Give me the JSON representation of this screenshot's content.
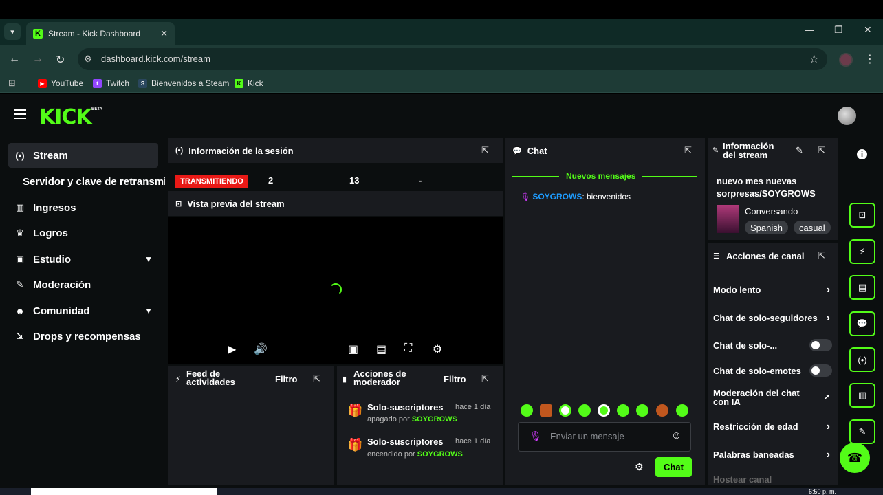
{
  "browser": {
    "tab_title": "Stream - Kick Dashboard",
    "favicon": "K",
    "tab_close": "✕",
    "new_tab": "+",
    "url": "dashboard.kick.com/stream",
    "bookmarks": [
      {
        "label": "YouTube",
        "icon": "youtube-icon",
        "color": "#ff0000"
      },
      {
        "label": "Twitch",
        "icon": "twitch-icon",
        "color": "#9146ff"
      },
      {
        "label": "Bienvenidos a Steam",
        "icon": "steam-icon",
        "color": "#1b2838"
      },
      {
        "label": "Kick",
        "icon": "kick-icon",
        "color": "#53fc18"
      }
    ]
  },
  "header": {
    "logo": "KICK",
    "beta": "BETA"
  },
  "sidebar": {
    "items": [
      {
        "label": "Stream",
        "icon": "stream-icon",
        "glyph": "(•)"
      },
      {
        "label": "Servidor y clave de retransmisión"
      },
      {
        "label": "Ingresos",
        "icon": "income-icon",
        "glyph": "▥"
      },
      {
        "label": "Logros",
        "icon": "trophy-icon",
        "glyph": "♛"
      },
      {
        "label": "Estudio",
        "icon": "studio-icon",
        "glyph": "▣"
      },
      {
        "label": "Moderación",
        "icon": "wrench-icon",
        "glyph": "✎"
      },
      {
        "label": "Comunidad",
        "icon": "community-icon",
        "glyph": "☻"
      },
      {
        "label": "Drops y recompensas",
        "icon": "drops-icon",
        "glyph": "⇲"
      }
    ]
  },
  "session": {
    "title": "Información de la sesión",
    "live_badge": "TRANSMITIENDO",
    "stats": [
      "2",
      "13",
      "-"
    ]
  },
  "preview": {
    "title": "Vista previa del stream"
  },
  "activity_feed": {
    "title_line1": "Feed de",
    "title_line2": "actividades",
    "filter": "Filtro"
  },
  "mod_actions": {
    "title_line1": "Acciones de",
    "title_line2": "moderador",
    "filter": "Filtro",
    "entries": [
      {
        "title": "Solo-suscriptores",
        "time": "hace 1 día",
        "by_text": "apagado por ",
        "by_user": "SOYGROWS"
      },
      {
        "title": "Solo-suscriptores",
        "time": "hace 1 día",
        "by_text": "encendido por ",
        "by_user": "SOYGROWS"
      }
    ]
  },
  "chat": {
    "title": "Chat",
    "new_messages": "Nuevos mensajes",
    "messages": [
      {
        "user": "SOYGROWS",
        "text": ": bienvenidos"
      }
    ],
    "input_placeholder": "Enviar un mensaje",
    "send_label": "Chat"
  },
  "stream_info": {
    "title_line1": "Información",
    "title_line2": "del stream",
    "stream_title_line1": "nuevo mes nuevas",
    "stream_title_line2": "sorpresas/SOYGROWS",
    "category": "Conversando",
    "tags": [
      "Spanish",
      "casual"
    ]
  },
  "channel_actions": {
    "title": "Acciones de canal",
    "rows": [
      {
        "label": "Modo lento",
        "control": "chevron"
      },
      {
        "label": "Chat de solo-seguidores",
        "control": "chevron"
      },
      {
        "label": "Chat de solo-...",
        "control": "toggle"
      },
      {
        "label": "Chat de solo-emotes",
        "control": "toggle"
      },
      {
        "label_line1": "Moderación del chat",
        "label_line2": "con IA",
        "control": "external"
      },
      {
        "label": "Restricción de edad",
        "control": "chevron"
      },
      {
        "label": "Palabras baneadas",
        "control": "chevron"
      },
      {
        "label": "Hostear canal",
        "control": "none"
      }
    ]
  },
  "taskbar": {
    "clock": "6:50 p. m."
  },
  "colors": {
    "brand_green": "#53fc18",
    "live_red": "#e91916",
    "username_blue": "#1e9cff"
  }
}
